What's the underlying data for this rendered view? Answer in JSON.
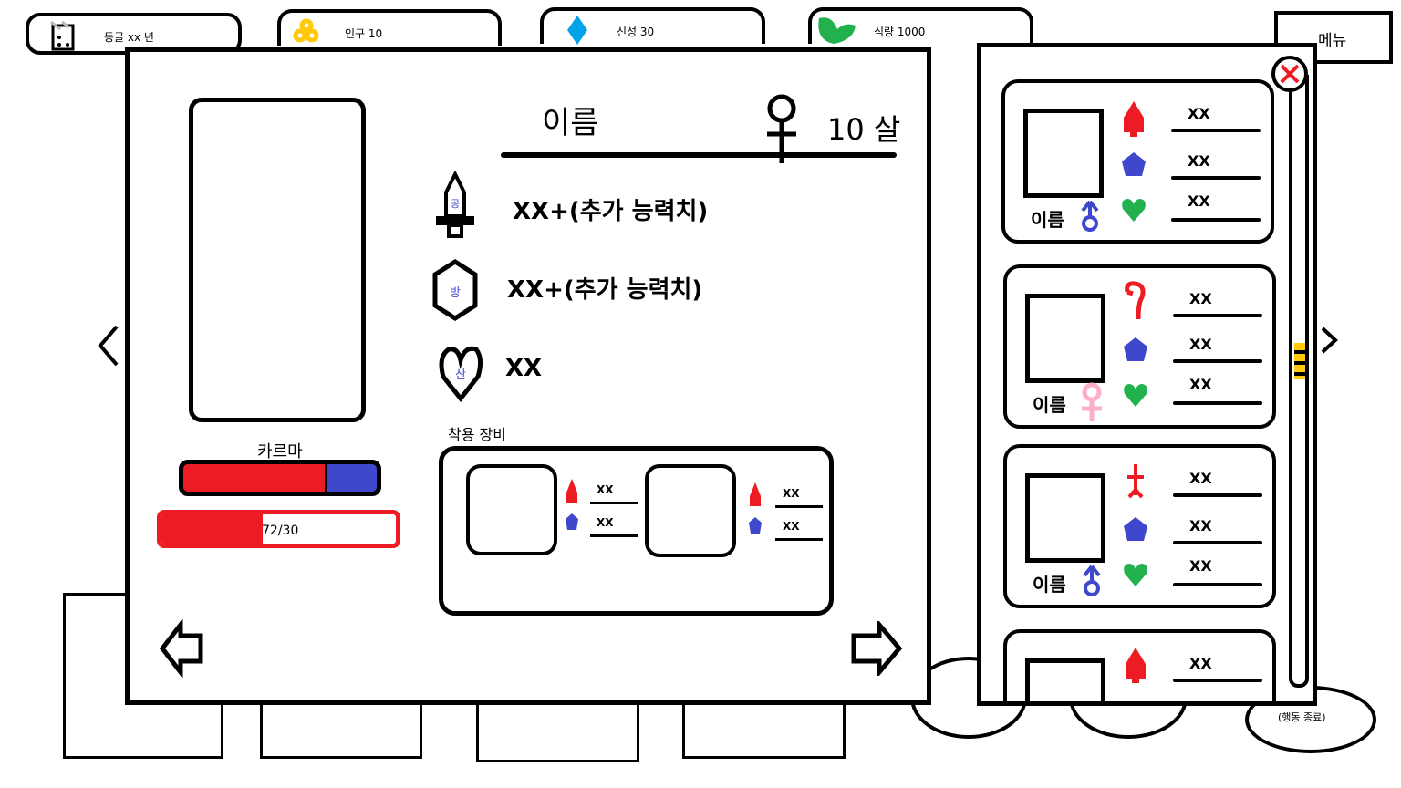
{
  "topbar": {
    "cave": {
      "label": "동굴 xx 년",
      "icon": "cave-calendar-icon"
    },
    "population": {
      "label": "인구 10",
      "icon": "population-coins-icon",
      "color": "#ffc90e"
    },
    "faith": {
      "label": "신성  30",
      "icon": "faith-diamond-icon",
      "color": "#00a2e8"
    },
    "food": {
      "label": "식량 1000",
      "icon": "food-leaf-icon",
      "color": "#22b14c"
    },
    "menu": "메뉴"
  },
  "end_turn": "(행동 종료)",
  "character": {
    "name": "이름",
    "gender": "female",
    "age": "10 살",
    "stats": [
      {
        "icon": "attack-sword-icon",
        "icon_label": "공",
        "value": "XX+(추가 능력치)"
      },
      {
        "icon": "defense-hexagon-icon",
        "icon_label": "방",
        "value": "XX+(추가 능력치)"
      },
      {
        "icon": "life-heart-icon",
        "icon_label": "산",
        "value": "XX"
      }
    ],
    "karma_label": "카르마",
    "karma_fraction": 0.74,
    "hp_text": "72/30",
    "hp_fraction": 0.43,
    "equipment_label": "착용 장비",
    "equipment": [
      {
        "stats": [
          "XX",
          "XX"
        ]
      },
      {
        "stats": [
          "XX",
          "XX"
        ]
      }
    ]
  },
  "roster": [
    {
      "name": "이름",
      "gender": "male",
      "weapon": "torch",
      "stats": [
        "XX",
        "XX",
        "XX"
      ]
    },
    {
      "name": "이름",
      "gender": "female",
      "weapon": "hook",
      "stats": [
        "XX",
        "XX",
        "XX"
      ]
    },
    {
      "name": "이름",
      "gender": "male",
      "weapon": "sword",
      "stats": [
        "XX",
        "XX",
        "XX"
      ]
    },
    {
      "name": "",
      "gender": "",
      "weapon": "torch",
      "stats": [
        "XX"
      ]
    }
  ],
  "colors": {
    "red": "#ed1c24",
    "blue": "#3f48cc",
    "green": "#22b14c",
    "pink": "#ffaec9",
    "yellow": "#ffc90e"
  }
}
